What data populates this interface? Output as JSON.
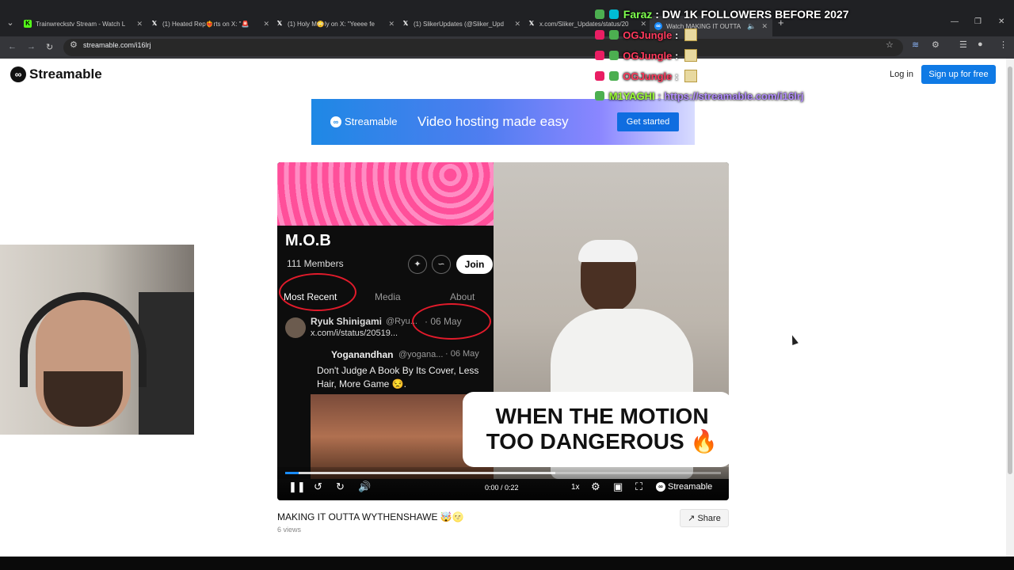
{
  "browser": {
    "tabs": [
      {
        "title": "Trainwreckstv Stream - Watch L",
        "favicon": "kick-icon",
        "favicon_color": "#53fc18"
      },
      {
        "title": "(1) Heated Rep❤️‍🔥rts on X: \"🚨",
        "favicon": "x-icon",
        "favicon_color": "#ffffff"
      },
      {
        "title": "(1) Holy M😳ly on X: \"Yeeee fe",
        "favicon": "x-icon",
        "favicon_color": "#ffffff"
      },
      {
        "title": "(1) SlikerUpdates (@Sliker_Upd",
        "favicon": "x-icon",
        "favicon_color": "#ffffff"
      },
      {
        "title": "x.com/Sliker_Updates/status/20",
        "favicon": "x-icon",
        "favicon_color": "#ffffff"
      },
      {
        "title": "Watch MAKING IT OUTTA W",
        "favicon": "streamable-icon",
        "favicon_color": "#1a8cff"
      }
    ],
    "url": "streamable.com/i16lrj"
  },
  "site": {
    "logo_text": "Streamable",
    "login_label": "Log in",
    "signup_label": "Sign up for free"
  },
  "ad": {
    "brand": "Streamable",
    "tagline": "Video hosting made easy",
    "cta": "Get started"
  },
  "video": {
    "left": {
      "group": "M.O.B",
      "members": "111 Members",
      "join_label": "Join",
      "tabs": [
        "Most Recent",
        "Media",
        "About"
      ],
      "post1": {
        "name": "Ryuk Shinigami",
        "handle": "@Ryu...",
        "date": "· 06 May",
        "link": "x.com/i/status/20519..."
      },
      "post2": {
        "name": "Yoganandhan",
        "handle": "@yogana...",
        "date": "· 06 May",
        "text": "Don't Judge A Book By Its Cover, Less Hair, More Game 😒."
      }
    },
    "caption": "WHEN THE MOTION TOO DANGEROUS 🔥",
    "controls": {
      "time": "0:00 / 0:22",
      "speed": "1x",
      "brand": "Streamable",
      "progress_played": 0.03,
      "progress_buffered": 0.62
    },
    "title": "MAKING IT OUTTA WYTHENSHAWE 🤯🌝",
    "views": "6 views",
    "share_label": "Share"
  },
  "chat": [
    {
      "user": "Faraz",
      "message": ": DW 1K FOLLOWERS BEFORE 2027",
      "color": "#7fff4f",
      "msg_color": "#ffffff"
    },
    {
      "user": "OGJungle",
      "message": ":",
      "color": "#ff3a5c",
      "msg_color": "#ffffff"
    },
    {
      "user": "OGJungle",
      "message": ":",
      "color": "#ff3a5c",
      "msg_color": "#ffffff"
    },
    {
      "user": "OGJungle",
      "message": ":",
      "color": "#ff3a5c",
      "msg_color": "#ffffff"
    },
    {
      "user": "M1YAGHI",
      "message": ": https://streamable.com/i16lrj",
      "color": "#9bff36",
      "msg_color": "#b38cff"
    }
  ]
}
